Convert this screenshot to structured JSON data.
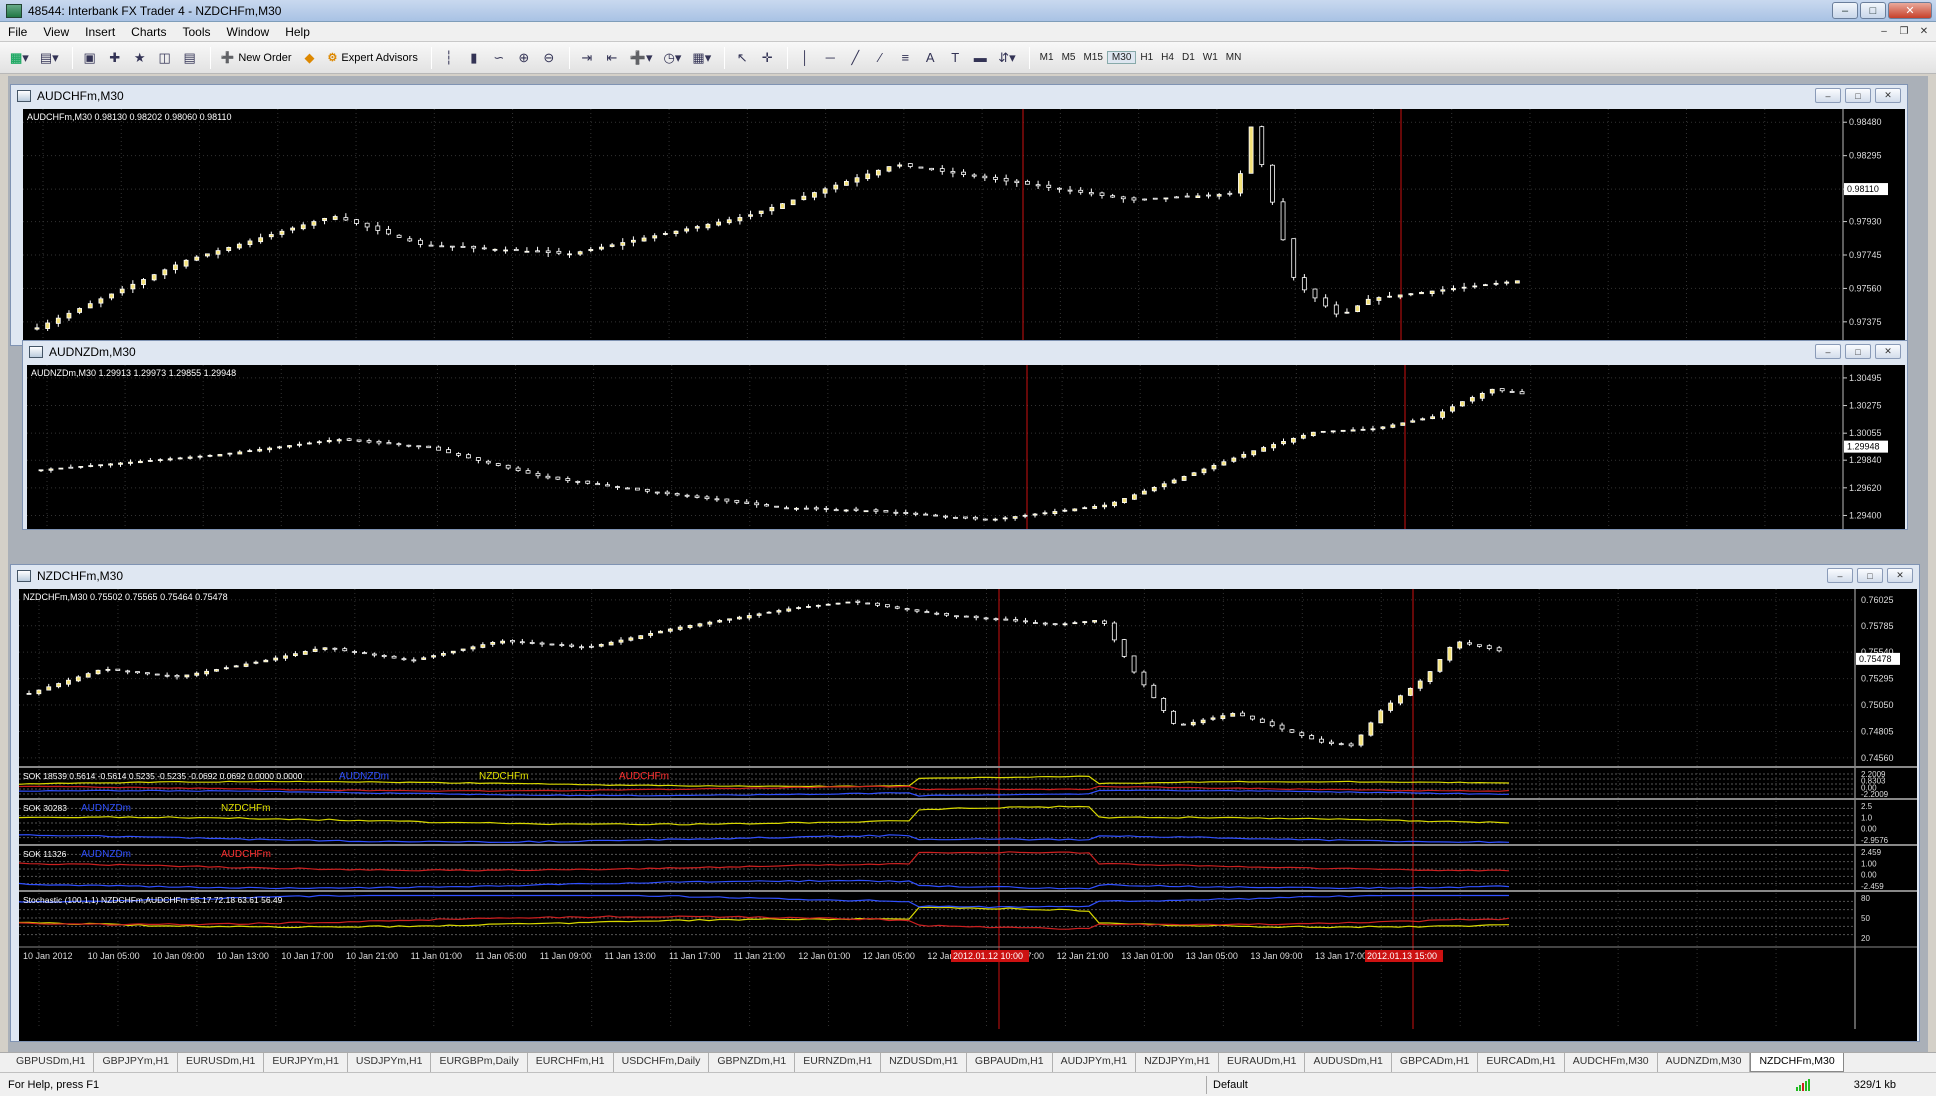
{
  "app": {
    "title": "48544: Interbank FX Trader 4 - NZDCHFm,M30"
  },
  "window_controls": [
    "minimize-button",
    "maximize-button",
    "close-button"
  ],
  "menu": [
    "File",
    "View",
    "Insert",
    "Charts",
    "Tools",
    "Window",
    "Help"
  ],
  "toolbar": {
    "new_order_label": "New Order",
    "expert_advisors_label": "Expert Advisors",
    "timeframes": [
      "M1",
      "M5",
      "M15",
      "M30",
      "H1",
      "H4",
      "D1",
      "W1",
      "MN"
    ],
    "active_timeframe": "M30"
  },
  "charts": [
    {
      "window_title": "AUDCHFm,M30",
      "info": "AUDCHFm,M30  0.98130 0.98202 0.98060 0.98110",
      "price_labels": [
        "0.98480",
        "0.98295",
        "0.98110",
        "0.97930",
        "0.97745",
        "0.97560",
        "0.97375"
      ],
      "current_price": "0.98110",
      "ymin": 0.9728,
      "ymax": 0.9852
    },
    {
      "window_title": "AUDNZDm,M30",
      "info": "AUDNZDm,M30  1.29913 1.29973 1.29855 1.29948",
      "price_labels": [
        "1.30495",
        "1.30275",
        "1.30055",
        "1.29840",
        "1.29620",
        "1.29400"
      ],
      "current_price": "1.29948",
      "ymin": 1.2934,
      "ymax": 1.3055
    },
    {
      "window_title": "NZDCHFm,M30",
      "info": "NZDCHFm,M30  0.75502 0.75565 0.75464 0.75478",
      "price_labels": [
        "0.76025",
        "0.75785",
        "0.75540",
        "0.75295",
        "0.75050",
        "0.74805",
        "0.74560"
      ],
      "current_price": "0.75478",
      "ymin": 0.7455,
      "ymax": 0.7607
    }
  ],
  "indicators": [
    {
      "label": "SOK 18539 0.5614 -0.5614 0.5235 -0.5235 -0.0692 0.0692 0.0000 0.0000",
      "tags": [
        "AUDNZDm",
        "NZDCHFm",
        "AUDCHFm"
      ],
      "scale": [
        "2.2009",
        "0.8303",
        "0.00",
        "-2.2009"
      ]
    },
    {
      "label": "SOK 30283",
      "tags": [
        "AUDNZDm",
        "NZDCHFm"
      ],
      "scale": [
        "2.5",
        "1.0",
        "0.00",
        "-2.9576"
      ]
    },
    {
      "label": "SOK 11326",
      "tags": [
        "AUDNZDm",
        "AUDCHFm"
      ],
      "scale": [
        "2.459",
        "1.00",
        "0.00",
        "-2.459"
      ]
    },
    {
      "label": "Stochastic (100,1,1) NZDCHFm,AUDCHFm 55.17 72.18 63.61 56.49",
      "tags": [],
      "scale": [
        "80",
        "50",
        "20"
      ]
    }
  ],
  "time_axis": [
    "10 Jan 2012",
    "10 Jan 05:00",
    "10 Jan 09:00",
    "10 Jan 13:00",
    "10 Jan 17:00",
    "10 Jan 21:00",
    "11 Jan 01:00",
    "11 Jan 05:00",
    "11 Jan 09:00",
    "11 Jan 13:00",
    "11 Jan 17:00",
    "11 Jan 21:00",
    "12 Jan 01:00",
    "12 Jan 05:00",
    "12 Jan 13:00",
    "12 Jan 17:00",
    "12 Jan 21:00",
    "13 Jan 01:00",
    "13 Jan 05:00",
    "13 Jan 09:00",
    "13 Jan 17:00"
  ],
  "time_markers": [
    "2012.01.12 10:00",
    "2012.01.13 15:00"
  ],
  "tabs": [
    "GBPUSDm,H1",
    "GBPJPYm,H1",
    "EURUSDm,H1",
    "EURJPYm,H1",
    "USDJPYm,H1",
    "EURGBPm,Daily",
    "EURCHFm,H1",
    "USDCHFm,Daily",
    "GBPNZDm,H1",
    "EURNZDm,H1",
    "NZDUSDm,H1",
    "GBPAUDm,H1",
    "AUDJPYm,H1",
    "NZDJPYm,H1",
    "EURAUDm,H1",
    "AUDUSDm,H1",
    "GBPCADm,H1",
    "EURCADm,H1",
    "AUDCHFm,M30",
    "AUDNZDm,M30",
    "NZDCHFm,M30"
  ],
  "active_tab": "NZDCHFm,M30",
  "status": {
    "help": "For Help, press F1",
    "profile": "Default",
    "traffic": "329/1 kb"
  },
  "colors": {
    "bull_candle": "#f4e27a",
    "bear_candle": "#000000",
    "candle_outline": "#ffffff",
    "marker_line": "#cc1111",
    "grid": "#333333"
  }
}
